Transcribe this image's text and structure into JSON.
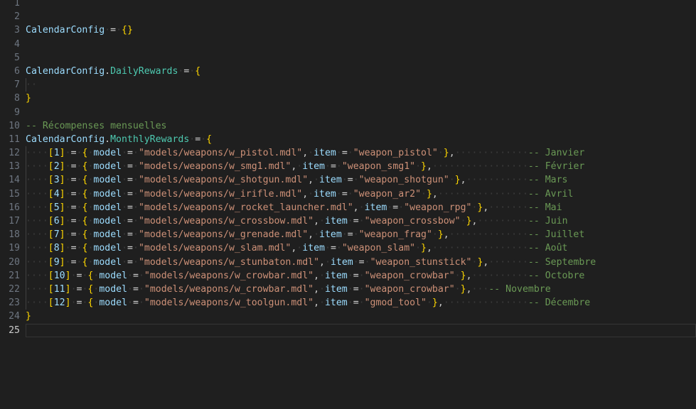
{
  "editor": {
    "language": "lua",
    "theme": "dark-modern",
    "background_color": "#1f1f1f",
    "gutter_color": "#6e7681",
    "active_line_number": 25,
    "first_visible_line": 1,
    "last_visible_line": 25,
    "render_whitespace": true,
    "whitespace_glyph": "·",
    "indent_guides": true
  },
  "colors": {
    "variable": "#9cdcfe",
    "property": "#4ec9b0",
    "string": "#ce9178",
    "comment": "#6a9955",
    "operator": "#d4d4d4",
    "bracket_1": "#ffd700",
    "bracket_2": "#da70d6",
    "bracket_3": "#179fff",
    "whitespace_dot": "#3b3b3b",
    "active_line_border": "#353535",
    "indent_guide": "#404040"
  },
  "code": {
    "root_table": "CalendarConfig",
    "empty_table": "{}",
    "daily_rewards_key": "CalendarConfig.DailyRewards",
    "monthly_rewards_key": "CalendarConfig.MonthlyRewards",
    "section_comment": "-- Récompenses mensuelles",
    "model_key": "model",
    "item_key": "item",
    "closing_brace": "}"
  },
  "lines": [
    {
      "n": 1,
      "text": ""
    },
    {
      "n": 2,
      "text": ""
    },
    {
      "n": 3,
      "text": "CalendarConfig = {}"
    },
    {
      "n": 4,
      "text": ""
    },
    {
      "n": 5,
      "text": ""
    },
    {
      "n": 6,
      "text": "CalendarConfig.DailyRewards = {"
    },
    {
      "n": 7,
      "text": "  "
    },
    {
      "n": 8,
      "text": "}"
    },
    {
      "n": 9,
      "text": ""
    },
    {
      "n": 10,
      "text": "-- Récompenses mensuelles"
    },
    {
      "n": 11,
      "text": "CalendarConfig.MonthlyRewards = {"
    },
    {
      "n": 12,
      "text": "    [1] = { model = \"models/weapons/w_pistol.mdl\", item = \"weapon_pistol\" },             -- Janvier"
    },
    {
      "n": 13,
      "text": "    [2] = { model = \"models/weapons/w_smg1.mdl\", item = \"weapon_smg1\" },                 -- Février"
    },
    {
      "n": 14,
      "text": "    [3] = { model = \"models/weapons/w_shotgun.mdl\", item = \"weapon_shotgun\" },           -- Mars"
    },
    {
      "n": 15,
      "text": "    [4] = { model = \"models/weapons/w_irifle.mdl\", item = \"weapon_ar2\" },                -- Avril"
    },
    {
      "n": 16,
      "text": "    [5] = { model = \"models/weapons/w_rocket_launcher.mdl\", item = \"weapon_rpg\" },       -- Mai"
    },
    {
      "n": 17,
      "text": "    [6] = { model = \"models/weapons/w_crossbow.mdl\", item = \"weapon_crossbow\" },         -- Juin"
    },
    {
      "n": 18,
      "text": "    [7] = { model = \"models/weapons/w_grenade.mdl\", item = \"weapon_frag\" },              -- Juillet"
    },
    {
      "n": 19,
      "text": "    [8] = { model = \"models/weapons/w_slam.mdl\", item = \"weapon_slam\" },                 -- Août"
    },
    {
      "n": 20,
      "text": "    [9] = { model = \"models/weapons/w_stunbaton.mdl\", item = \"weapon_stunstick\" },       -- Septembre"
    },
    {
      "n": 21,
      "text": "    [10] = { model = \"models/weapons/w_crowbar.mdl\", item = \"weapon_crowbar\" },          -- Octobre"
    },
    {
      "n": 22,
      "text": "    [11] = { model = \"models/weapons/w_crowbar.mdl\", item = \"weapon_crowbar\" },   -- Novembre"
    },
    {
      "n": 23,
      "text": "    [12] = { model = \"models/weapons/w_toolgun.mdl\", item = \"gmod_tool\" },               -- Décembre"
    },
    {
      "n": 24,
      "text": "}"
    },
    {
      "n": 25,
      "text": ""
    }
  ],
  "monthly_rewards": [
    {
      "index": 1,
      "model": "models/weapons/w_pistol.mdl",
      "item": "weapon_pistol",
      "month_comment": "Janvier",
      "dots_before_comment": 13
    },
    {
      "index": 2,
      "model": "models/weapons/w_smg1.mdl",
      "item": "weapon_smg1",
      "month_comment": "Février",
      "dots_before_comment": 17
    },
    {
      "index": 3,
      "model": "models/weapons/w_shotgun.mdl",
      "item": "weapon_shotgun",
      "month_comment": "Mars",
      "dots_before_comment": 11
    },
    {
      "index": 4,
      "model": "models/weapons/w_irifle.mdl",
      "item": "weapon_ar2",
      "month_comment": "Avril",
      "dots_before_comment": 16
    },
    {
      "index": 5,
      "model": "models/weapons/w_rocket_launcher.mdl",
      "item": "weapon_rpg",
      "month_comment": "Mai",
      "dots_before_comment": 8
    },
    {
      "index": 6,
      "model": "models/weapons/w_crossbow.mdl",
      "item": "weapon_crossbow",
      "month_comment": "Juin",
      "dots_before_comment": 10
    },
    {
      "index": 7,
      "model": "models/weapons/w_grenade.mdl",
      "item": "weapon_frag",
      "month_comment": "Juillet",
      "dots_before_comment": 14
    },
    {
      "index": 8,
      "model": "models/weapons/w_slam.mdl",
      "item": "weapon_slam",
      "month_comment": "Août",
      "dots_before_comment": 17
    },
    {
      "index": 9,
      "model": "models/weapons/w_stunbaton.mdl",
      "item": "weapon_stunstick",
      "month_comment": "Septembre",
      "dots_before_comment": 8
    },
    {
      "index": 10,
      "model": "models/weapons/w_crowbar.mdl",
      "item": "weapon_crowbar",
      "month_comment": "Octobre",
      "dots_before_comment": 11
    },
    {
      "index": 11,
      "model": "models/weapons/w_crowbar.mdl",
      "item": "weapon_crowbar",
      "month_comment": "Novembre",
      "dots_before_comment": 4
    },
    {
      "index": 12,
      "model": "models/weapons/w_toolgun.mdl",
      "item": "gmod_tool",
      "month_comment": "Décembre",
      "dots_before_comment": 15
    }
  ]
}
